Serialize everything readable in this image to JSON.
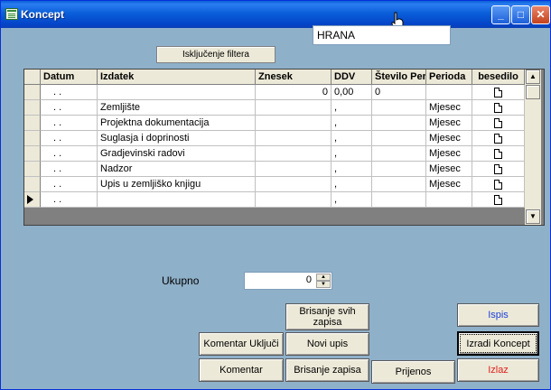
{
  "window": {
    "title": "Koncept"
  },
  "search": {
    "value": "HRANA"
  },
  "filter_button": "Isključenje filtera",
  "grid": {
    "columns": [
      "Datum",
      "Izdatek",
      "Znesek",
      "DDV",
      "Število Peri",
      "Perioda",
      "besedilo"
    ],
    "rows": [
      {
        "datum": ". .",
        "izdatek": "",
        "znesek": "0",
        "ddv": "0,00",
        "stevilo": "0",
        "perioda": ""
      },
      {
        "datum": ". .",
        "izdatek": "Zemljište",
        "znesek": "",
        "ddv": ",",
        "stevilo": "",
        "perioda": "Mjesec"
      },
      {
        "datum": ". .",
        "izdatek": "Projektna dokumentacija",
        "znesek": "",
        "ddv": ",",
        "stevilo": "",
        "perioda": "Mjesec"
      },
      {
        "datum": ". .",
        "izdatek": "Suglasja i doprinosti",
        "znesek": "",
        "ddv": ",",
        "stevilo": "",
        "perioda": "Mjesec"
      },
      {
        "datum": ". .",
        "izdatek": "Gradjevinski radovi",
        "znesek": "",
        "ddv": ",",
        "stevilo": "",
        "perioda": "Mjesec"
      },
      {
        "datum": ". .",
        "izdatek": "Nadzor",
        "znesek": "",
        "ddv": ",",
        "stevilo": "",
        "perioda": "Mjesec"
      },
      {
        "datum": ". .",
        "izdatek": "Upis u zemljiško knjigu",
        "znesek": "",
        "ddv": ",",
        "stevilo": "",
        "perioda": "Mjesec"
      },
      {
        "datum": ". .",
        "izdatek": "",
        "znesek": "",
        "ddv": ",",
        "stevilo": "",
        "perioda": ""
      }
    ]
  },
  "ukupno": {
    "label": "Ukupno",
    "value": "0"
  },
  "buttons": {
    "brisanje_svih": "Brisanje svih zapisa",
    "ispis": "Ispis",
    "komentar_ukljuci": "Komentar Uključi",
    "novi_upis": "Novi upis",
    "izradi_koncept": "Izradi Koncept",
    "komentar": "Komentar",
    "brisanje_zapisa": "Brisanje zapisa",
    "prijenos": "Prijenos",
    "izlaz": "Izlaz"
  },
  "colors": {
    "titlebar": "#0a5fd9",
    "background": "#8fb0c9",
    "ispis_text": "#1a3fd9",
    "izlaz_text": "#e0201a"
  }
}
